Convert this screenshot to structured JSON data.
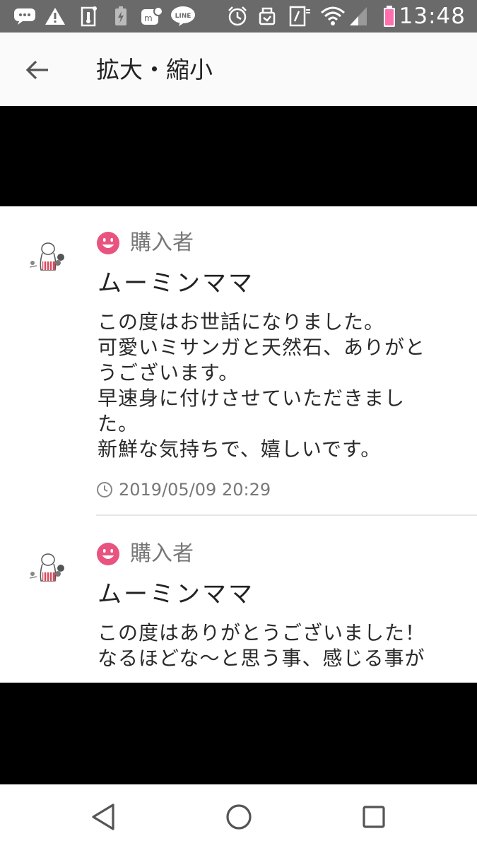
{
  "status_bar": {
    "time": "13:48",
    "icons": [
      "message-icon",
      "warning-icon",
      "thermometer-icon",
      "battery-saver-icon",
      "mercari-app-icon",
      "line-app-icon",
      "alarm-icon",
      "notification-icon",
      "nfc-icon",
      "wifi-icon",
      "signal-icon",
      "battery-icon"
    ],
    "app_badge": "LINE",
    "battery_color": "#ff6fae"
  },
  "app_bar": {
    "title": "拡大・縮小"
  },
  "colors": {
    "accent": "#e8537f",
    "statusbar": "#6a6a6a"
  },
  "reviews": [
    {
      "role": "購入者",
      "name": "ムーミンママ",
      "lines": [
        "この度はお世話になりました。",
        "可愛いミサンガと天然石、ありがと",
        "うございます。",
        "早速身に付けさせていただきまし",
        "た。",
        "新鮮な気持ちで、嬉しいです。"
      ],
      "timestamp": "2019/05/09 20:29"
    },
    {
      "role": "購入者",
      "name": "ムーミンママ",
      "lines": [
        "この度はありがとうございました！",
        "なるほどな〜と思う事、感じる事が"
      ]
    }
  ]
}
